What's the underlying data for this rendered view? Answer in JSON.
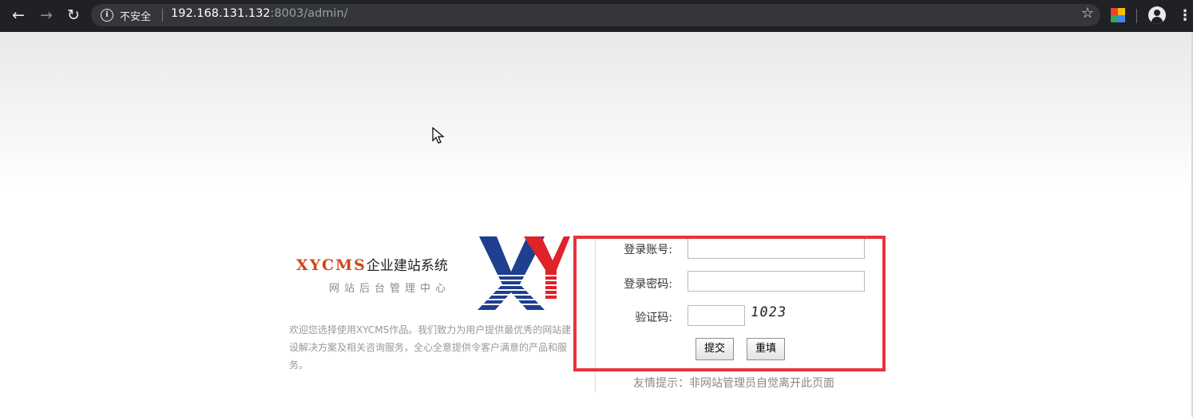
{
  "browser": {
    "security_label": "不安全",
    "url_host": "192.168.131.132",
    "url_rest": ":8003/admin/",
    "icons": {
      "back": "back-arrow-icon",
      "forward": "forward-arrow-icon",
      "reload": "reload-icon",
      "info": "info-icon",
      "star": "star-icon",
      "extension": "extension-icon",
      "profile": "profile-icon",
      "menu": "more-menu-icon"
    }
  },
  "branding": {
    "brand_name": "XYCMS",
    "brand_suffix": "企业建站系统",
    "subtitle": "网站后台管理中心",
    "intro": "欢迎您选择使用XYCMS作品。我们致力为用户提供最优秀的网站建设解决方案及相关咨询服务，全心全意提供令客户满意的产品和服务。"
  },
  "login": {
    "account_label": "登录账号:",
    "account_value": "",
    "password_label": "登录密码:",
    "password_value": "",
    "captcha_label": "验证码:",
    "captcha_value": "",
    "captcha_code": "1023",
    "submit_label": "提交",
    "reset_label": "重填",
    "hint": "友情提示：非网站管理员自觉离开此页面"
  },
  "colors": {
    "brand_orange": "#d2461a",
    "logo_blue": "#1f3f8f",
    "logo_red": "#e0222a",
    "highlight_red": "#e8333a",
    "chrome_dark": "#202124"
  }
}
